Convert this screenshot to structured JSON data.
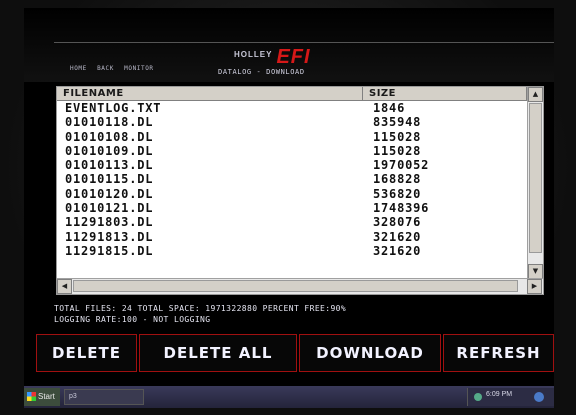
{
  "nav": {
    "items": [
      "HOME",
      "BACK",
      "MONITOR"
    ]
  },
  "brand": {
    "name": "HOLLEY",
    "efi": "EFI"
  },
  "page_title": "DATALOG - DOWNLOAD",
  "table": {
    "columns": [
      "FILENAME",
      "SIZE"
    ],
    "rows": [
      [
        "EVENTLOG.TXT",
        "1846"
      ],
      [
        "01010118.DL",
        "835948"
      ],
      [
        "01010108.DL",
        "115028"
      ],
      [
        "01010109.DL",
        "115028"
      ],
      [
        "01010113.DL",
        "1970052"
      ],
      [
        "01010115.DL",
        "168828"
      ],
      [
        "01010120.DL",
        "536820"
      ],
      [
        "01010121.DL",
        "1748396"
      ],
      [
        "11291803.DL",
        "328076"
      ],
      [
        "11291813.DL",
        "321620"
      ],
      [
        "11291815.DL",
        "321620"
      ]
    ]
  },
  "status": {
    "line1": "TOTAL FILES: 24 TOTAL SPACE: 1971322880 PERCENT FREE:90%",
    "line2": "LOGGING RATE:100 - NOT LOGGING"
  },
  "buttons": {
    "delete": "DELETE",
    "delete_all": "DELETE ALL",
    "download": "DOWNLOAD",
    "refresh": "REFRESH"
  },
  "taskbar": {
    "start": "Start",
    "task": "p3",
    "clock": "6:09 PM"
  },
  "icons": {
    "scroll_up": "▲",
    "scroll_down": "▼",
    "scroll_left": "◀",
    "scroll_right": "▶"
  },
  "colors": {
    "accent": "#d61818",
    "button_border": "#a01010"
  }
}
